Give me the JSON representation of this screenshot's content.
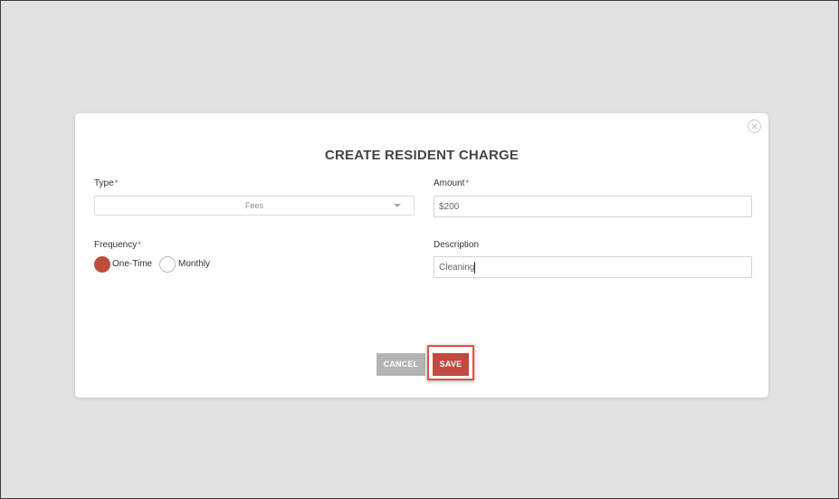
{
  "dialog": {
    "title": "CREATE RESIDENT CHARGE",
    "close_icon": "close-icon"
  },
  "fields": {
    "type": {
      "label": "Type",
      "required_mark": "*",
      "selected": "Fees"
    },
    "amount": {
      "label": "Amount",
      "required_mark": "*",
      "value": "$200"
    },
    "frequency": {
      "label": "Frequency",
      "required_mark": "*",
      "options": [
        {
          "label": "One-Time",
          "selected": true
        },
        {
          "label": "Monthly",
          "selected": false
        }
      ]
    },
    "description": {
      "label": "Description",
      "value": "Cleaning"
    }
  },
  "actions": {
    "cancel_label": "CANCEL",
    "save_label": "SAVE"
  },
  "colors": {
    "accent": "#bf4a3d",
    "cancel": "#b4b4b4",
    "highlight": "#e84a4a",
    "backdrop": "#e2e2e2"
  }
}
